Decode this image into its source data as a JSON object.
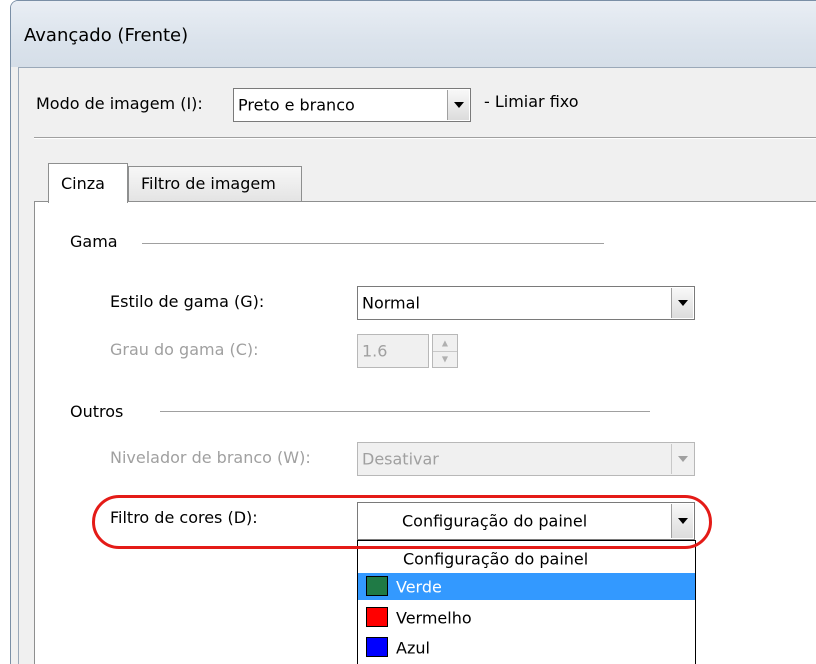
{
  "window": {
    "title": "Avançado (Frente)"
  },
  "image_mode": {
    "label": "Modo de imagem (I):",
    "value": "Preto e branco",
    "note": "- Limiar fixo"
  },
  "tabs": [
    {
      "label": "Cinza",
      "active": true
    },
    {
      "label": "Filtro de imagem",
      "active": false
    }
  ],
  "gamma": {
    "heading": "Gama",
    "style_label": "Estilo de gama (G):",
    "style_value": "Normal",
    "degree_label": "Grau do gama (C):",
    "degree_value": "1.6"
  },
  "others": {
    "heading": "Outros",
    "white_level_label": "Nivelador de branco (W):",
    "white_level_value": "Desativar",
    "color_filter_label": "Filtro de cores (D):",
    "color_filter_value": "Configuração do painel"
  },
  "dropdown": {
    "options": [
      {
        "label": "Configuração do painel",
        "swatch": null
      },
      {
        "label": "Verde",
        "swatch": "#1f7a45",
        "selected": true
      },
      {
        "label": "Vermelho",
        "swatch": "#ff0000"
      },
      {
        "label": "Azul",
        "swatch": "#0000ff"
      }
    ]
  },
  "colors": {
    "highlight": "#e41b17",
    "selection": "#3399ff"
  }
}
